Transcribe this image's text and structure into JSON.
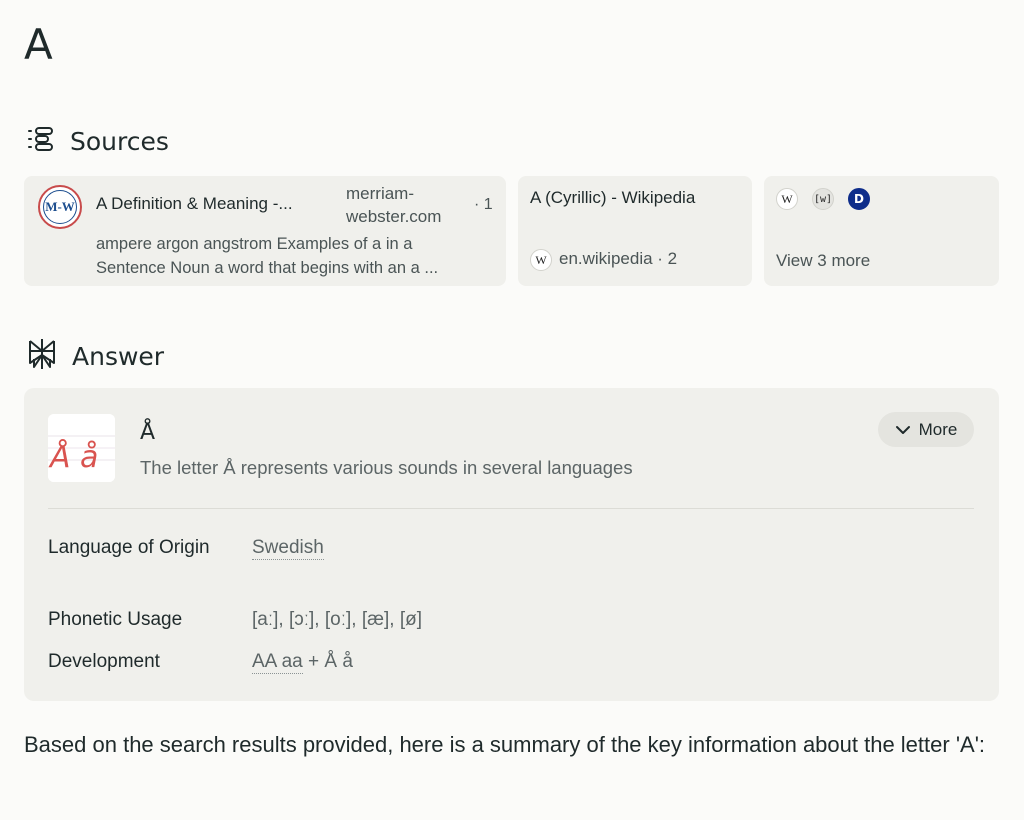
{
  "query": {
    "title": "A"
  },
  "sources": {
    "heading": "Sources",
    "cards": [
      {
        "title": "A Definition & Meaning -...",
        "domain": "merriam-webster.com",
        "index": "· 1",
        "logo_text": "M-W",
        "snippet_line1": "ampere argon angstrom Examples of a in a",
        "snippet_line2": "Sentence Noun a word that begins with an a ..."
      },
      {
        "title": "A (Cyrillic) - Wikipedia",
        "domain": "en.wikipedia · 2",
        "logo_text": "W"
      },
      {
        "icons": [
          "W",
          "[w]",
          "D"
        ],
        "view_more": "View 3 more"
      }
    ]
  },
  "answer": {
    "heading": "Answer",
    "card": {
      "title": "Å",
      "subtitle": "The letter Å represents various sounds in several languages",
      "more_label": "More",
      "thumbnail_glyphs": "Å å",
      "properties": [
        {
          "label": "Language of Origin",
          "value_link": "Swedish",
          "value_rest": ""
        },
        {
          "label": "Phonetic Usage",
          "value_link": "",
          "value_rest": "[aː], [ɔː], [oː], [æ], [ø]"
        },
        {
          "label": "Development",
          "value_link": "AA aa",
          "value_rest": " + Å å"
        }
      ]
    }
  },
  "summary": {
    "text": "Based on the search results provided, here is a summary of the key information about the letter 'A':"
  },
  "colors": {
    "background": "#fbfbf9",
    "card": "#f0f0ec",
    "text": "#1f2a2b",
    "muted": "#5c6566",
    "thumb_ink": "#d9534f"
  }
}
